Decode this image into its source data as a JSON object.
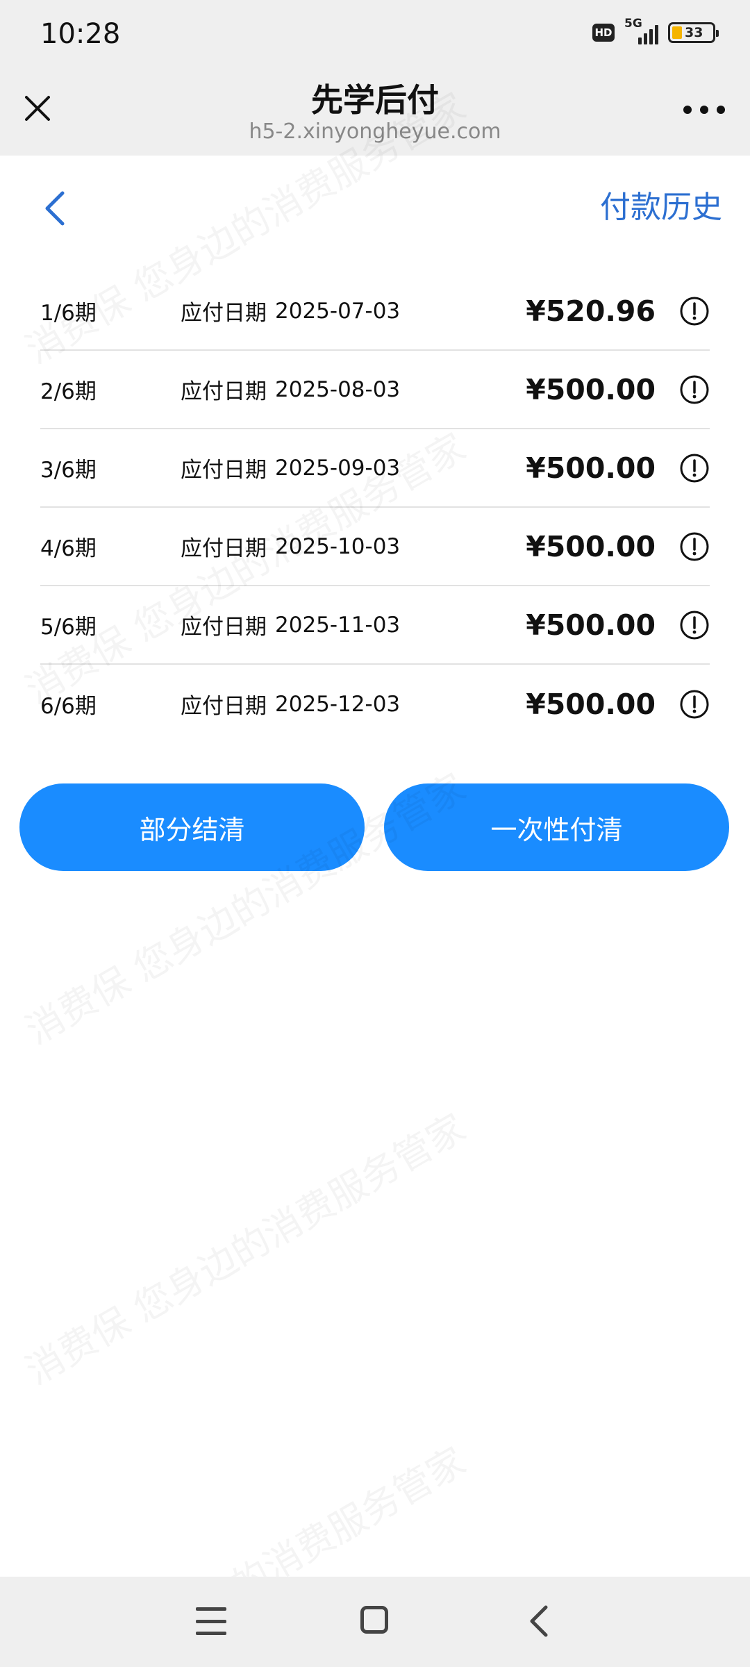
{
  "status_bar": {
    "time": "10:28",
    "hd": "HD",
    "network": "5G",
    "battery": "33"
  },
  "header": {
    "title": "先学后付",
    "url": "h5-2.xinyongheyue.com"
  },
  "subheader": {
    "history_label": "付款历史"
  },
  "installments": [
    {
      "period": "1/6期",
      "due_label": "应付日期",
      "due_date": "2025-07-03",
      "amount": "¥520.96"
    },
    {
      "period": "2/6期",
      "due_label": "应付日期",
      "due_date": "2025-08-03",
      "amount": "¥500.00"
    },
    {
      "period": "3/6期",
      "due_label": "应付日期",
      "due_date": "2025-09-03",
      "amount": "¥500.00"
    },
    {
      "period": "4/6期",
      "due_label": "应付日期",
      "due_date": "2025-10-03",
      "amount": "¥500.00"
    },
    {
      "period": "5/6期",
      "due_label": "应付日期",
      "due_date": "2025-11-03",
      "amount": "¥500.00"
    },
    {
      "period": "6/6期",
      "due_label": "应付日期",
      "due_date": "2025-12-03",
      "amount": "¥500.00"
    }
  ],
  "buttons": {
    "partial": "部分结清",
    "full": "一次性付清"
  },
  "watermark": {
    "line1": "消费保 您身边的消费服务管家"
  },
  "colors": {
    "accent": "#1a8cff",
    "link": "#2c6fd1"
  }
}
